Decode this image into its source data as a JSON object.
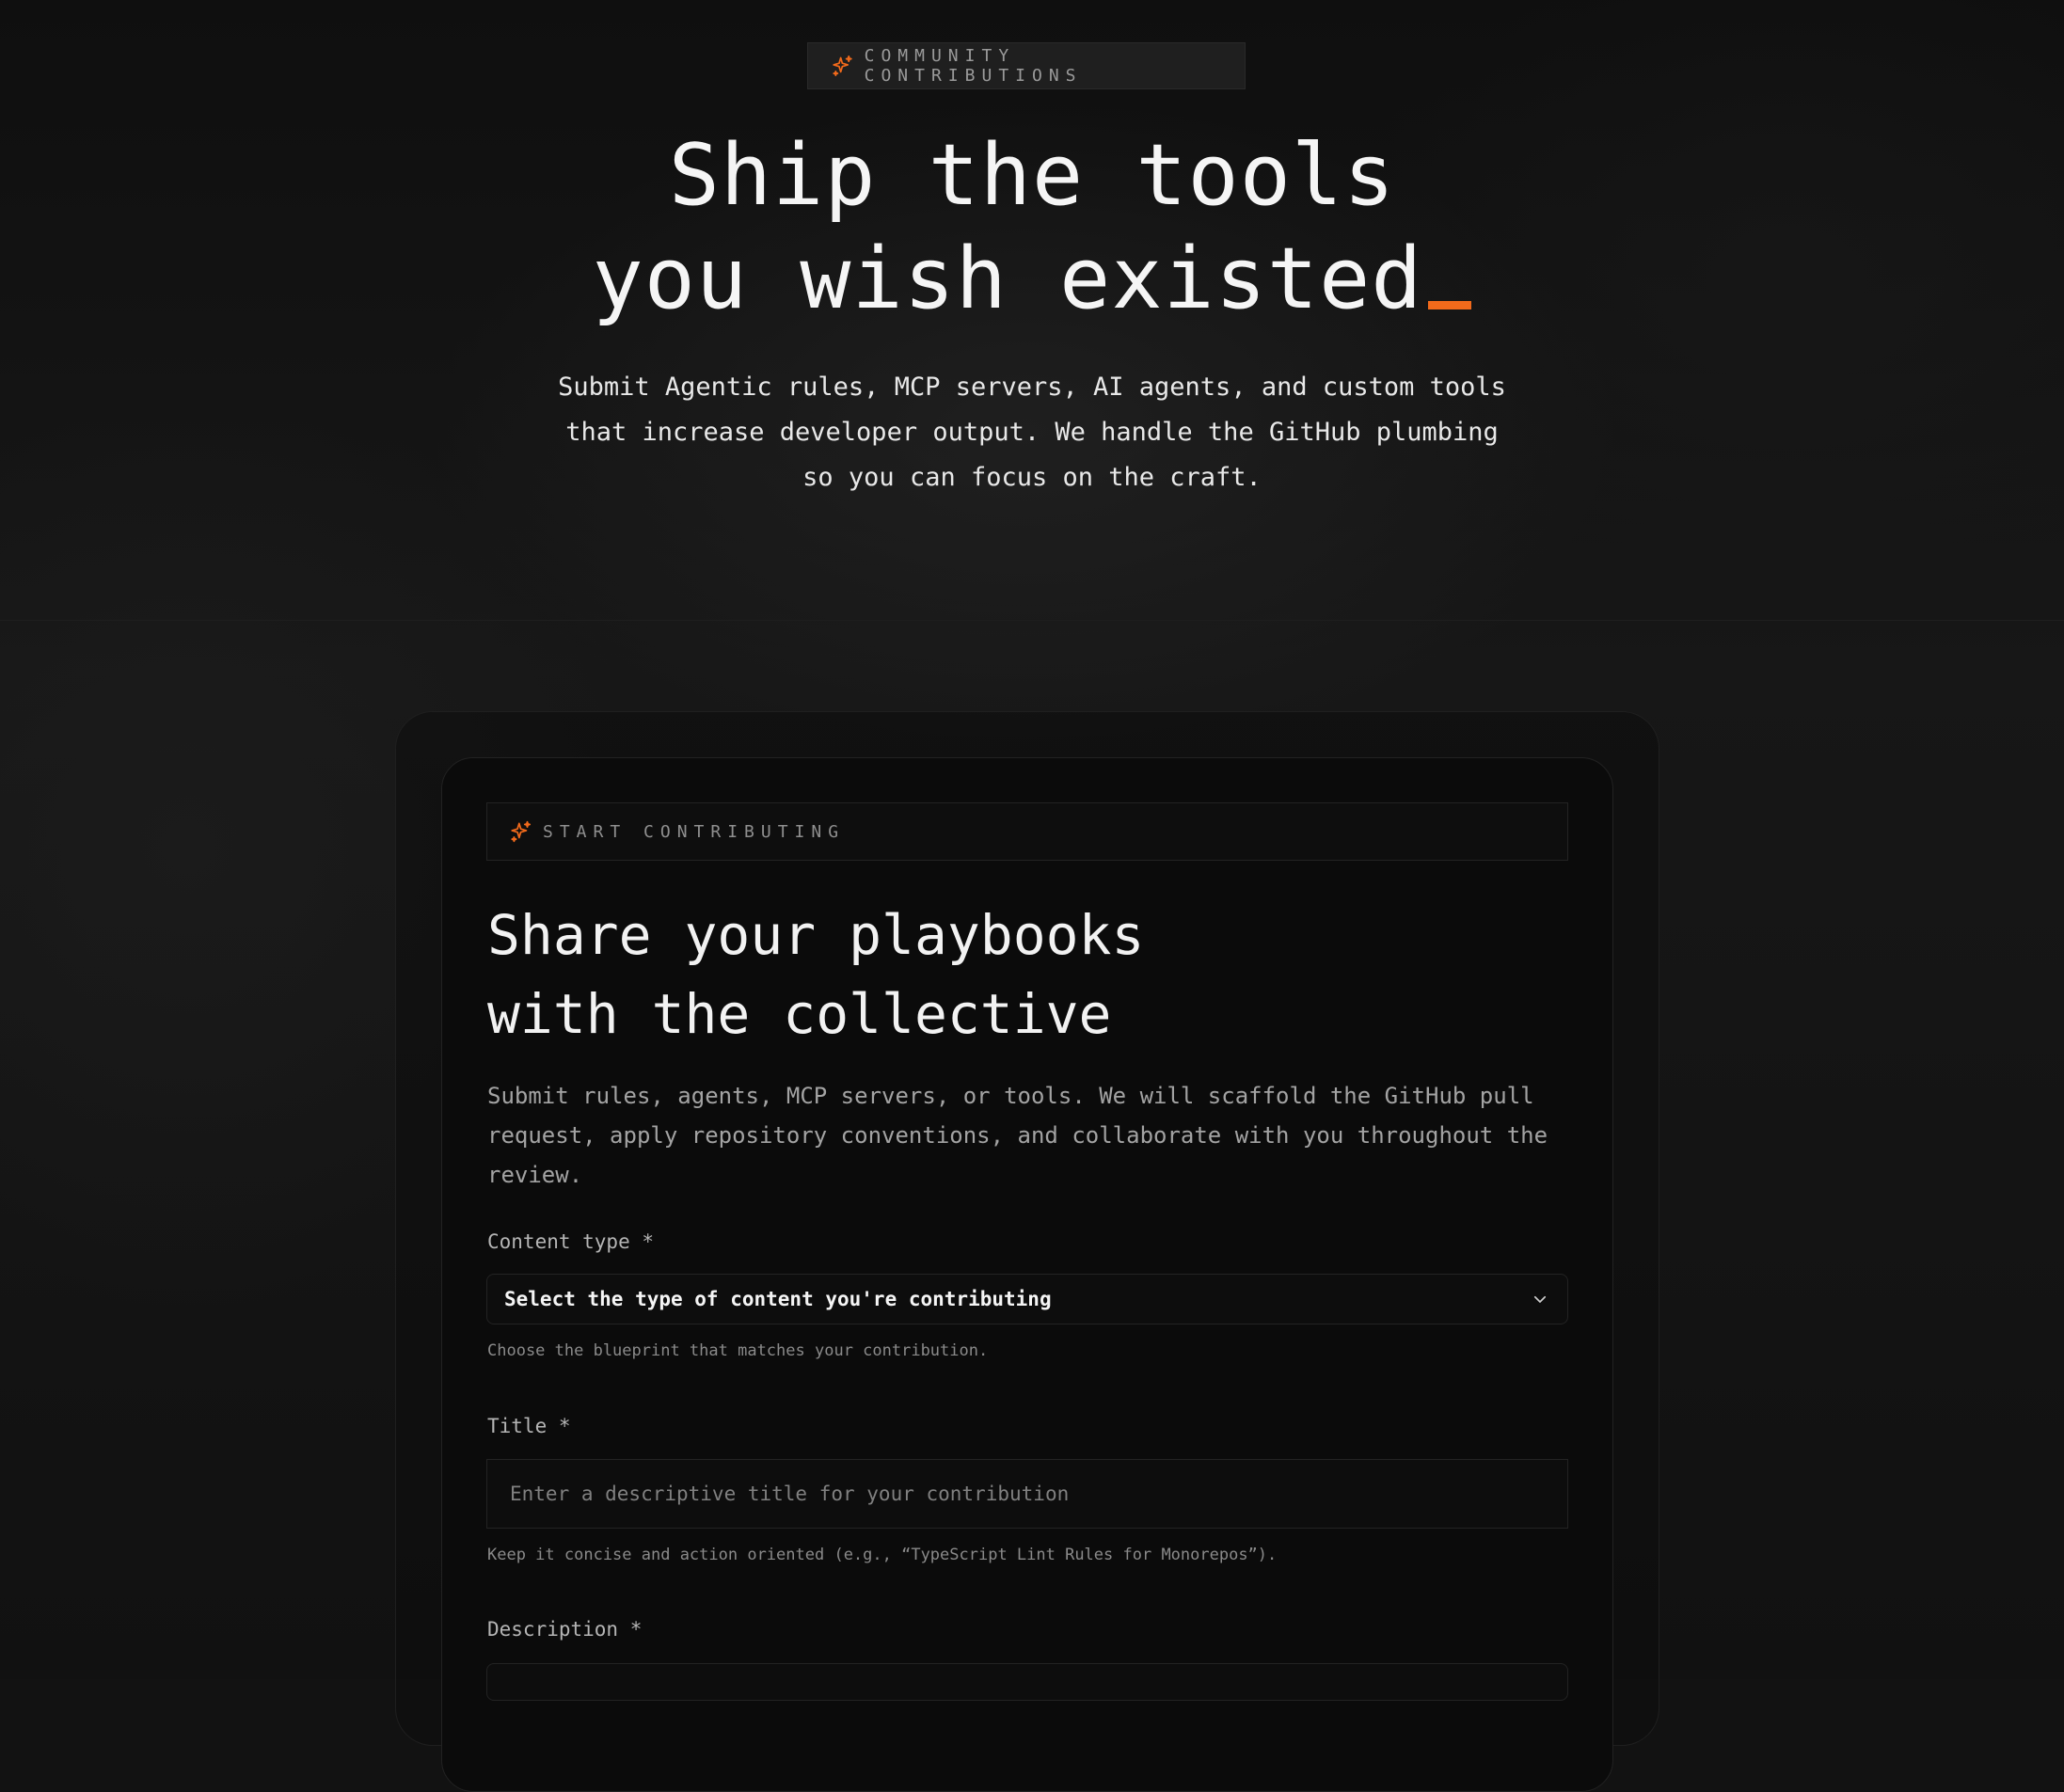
{
  "colors": {
    "accent": "#f26a1b",
    "background": "#121212",
    "card": "#0b0b0b"
  },
  "hero": {
    "badge_icon": "sparkles-icon",
    "badge": "COMMUNITY CONTRIBUTIONS",
    "title_line1": "Ship the tools",
    "title_line2": "you wish existed",
    "subtitle_line1": "Submit Agentic rules, MCP servers, AI agents, and custom tools",
    "subtitle_line2": "that increase developer output. We handle the GitHub plumbing",
    "subtitle_line3": "so you can focus on the craft."
  },
  "form": {
    "section_icon": "sparkles-icon",
    "section_label": "START CONTRIBUTING",
    "title_line1": "Share your playbooks",
    "title_line2": "with the collective",
    "description": "Submit rules, agents, MCP servers, or tools. We will scaffold the GitHub pull request, apply repository conventions, and collaborate with you throughout the review.",
    "content_type": {
      "label": "Content type *",
      "selected": "Select the type of content you're contributing",
      "chevron_icon": "chevron-down-icon",
      "help": "Choose the blueprint that matches your contribution."
    },
    "title_field": {
      "label": "Title *",
      "placeholder": "Enter a descriptive title for your contribution",
      "help": "Keep it concise and action oriented (e.g., “TypeScript Lint Rules for Monorepos”)."
    },
    "description_field": {
      "label": "Description *"
    }
  }
}
